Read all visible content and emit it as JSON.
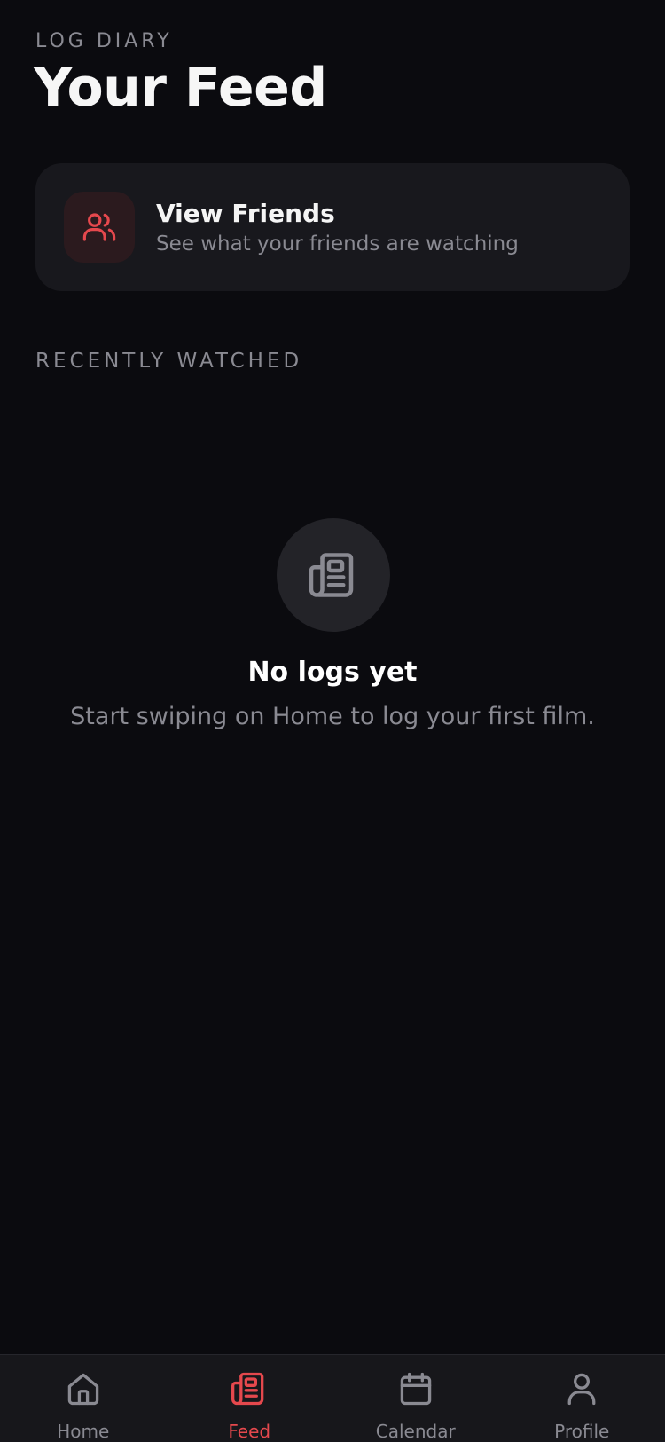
{
  "header": {
    "eyebrow": "LOG DIARY",
    "title": "Your Feed"
  },
  "friends_card": {
    "title": "View Friends",
    "subtitle": "See what your friends are watching",
    "icon": "users-icon"
  },
  "section": {
    "label": "RECENTLY WATCHED"
  },
  "empty_state": {
    "icon": "newspaper-icon",
    "title": "No logs yet",
    "message": "Start swiping on Home to log your first film."
  },
  "tabbar": {
    "active": "Feed",
    "tabs": [
      {
        "label": "Home",
        "icon": "home-icon"
      },
      {
        "label": "Feed",
        "icon": "newspaper-icon"
      },
      {
        "label": "Calendar",
        "icon": "calendar-icon"
      },
      {
        "label": "Profile",
        "icon": "user-icon"
      }
    ]
  },
  "colors": {
    "background": "#0b0b0f",
    "card": "#18181d",
    "accent": "#e5484d",
    "muted_text": "#8a8a92"
  }
}
